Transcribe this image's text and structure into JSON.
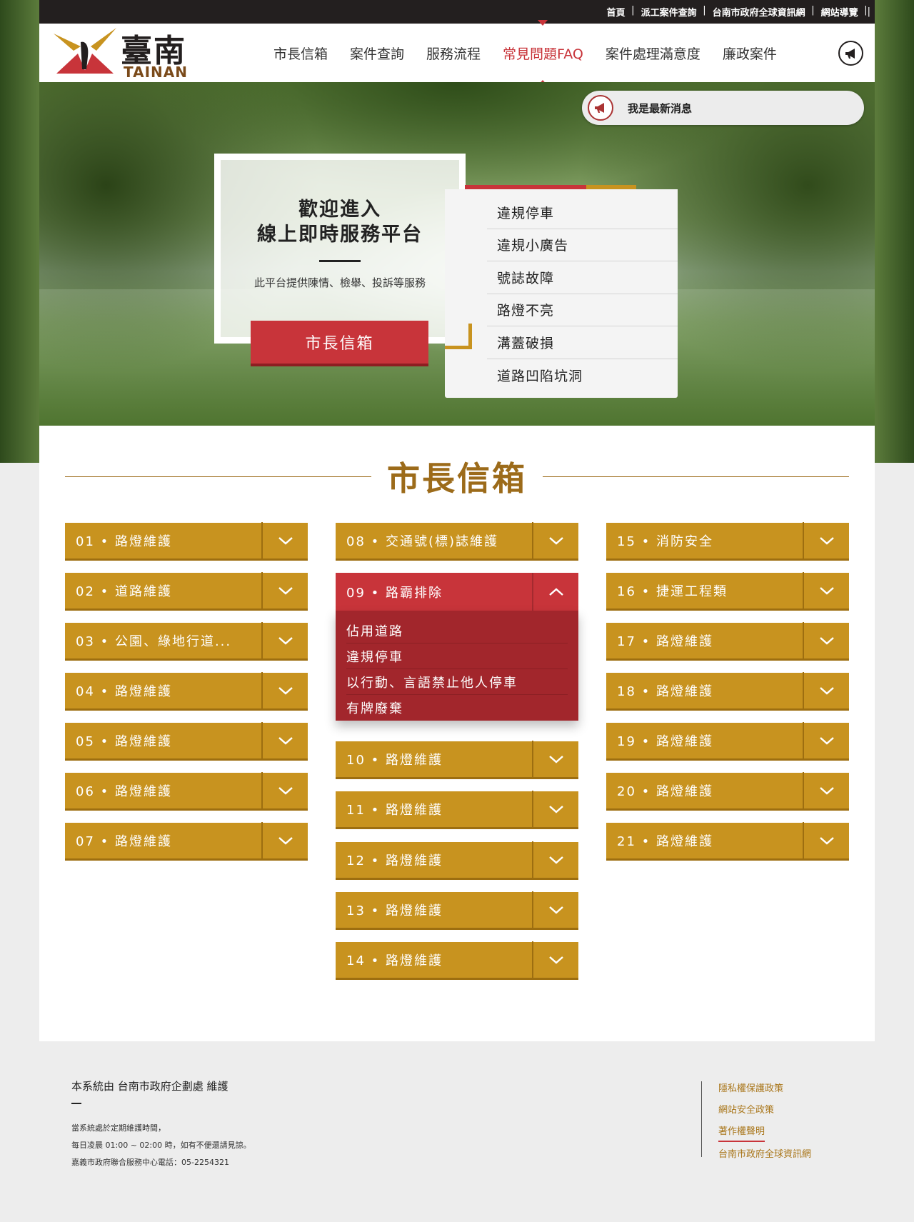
{
  "top_links": [
    "首頁",
    "派工案件查詢",
    "台南市政府全球資訊網",
    "網站導覽"
  ],
  "logo": {
    "chinese": "臺南",
    "english": "TAINAN"
  },
  "nav": [
    "市長信箱",
    "案件查詢",
    "服務流程",
    "常見問題FAQ",
    "案件處理滿意度",
    "廉政案件"
  ],
  "nav_active": "常見問題FAQ",
  "news": "我是最新消息",
  "welcome": {
    "line1": "歡迎進入",
    "line2": "線上即時服務平台",
    "desc": "此平台提供陳情、檢舉、投訴等服務",
    "button": "市長信箱"
  },
  "quick_links": [
    "違規停車",
    "違規小廣告",
    "號誌故障",
    "路燈不亮",
    "溝蓋破損",
    "道路凹陷坑洞"
  ],
  "section_title": "市長信箱",
  "accordion": {
    "col1": [
      "01 • 路燈維護",
      "02 • 道路維護",
      "03 • 公園、綠地行道...",
      "04 • 路燈維護",
      "05 • 路燈維護",
      "06 • 路燈維護",
      "07 • 路燈維護"
    ],
    "col2": [
      "08 • 交通號(標)誌維護",
      "09 • 路霸排除",
      "10 • 路燈維護",
      "11 • 路燈維護",
      "12 • 路燈維護",
      "13 • 路燈維護",
      "14 • 路燈維護"
    ],
    "col3": [
      "15 • 消防安全",
      "16 • 捷運工程類",
      "17 • 路燈維護",
      "18 • 路燈維護",
      "19 • 路燈維護",
      "20 • 路燈維護",
      "21 • 路燈維護"
    ],
    "open_item": "09 • 路霸排除",
    "open_items": [
      "佔用道路",
      "違規停車",
      "以行動、言語禁止他人停車",
      "有牌廢棄"
    ]
  },
  "footer": {
    "maintainer": "本系統由 台南市政府企劃處 維護",
    "notes": [
      "當系統處於定期維護時間，",
      "每日凌晨 01:00 ~ 02:00 時，如有不便還請見諒。",
      "嘉義市政府聯合服務中心電話：05-2254321"
    ],
    "links": [
      "隱私權保護政策",
      "網站安全政策",
      "著作權聲明",
      "台南市政府全球資訊網"
    ],
    "active_link": "著作權聲明"
  },
  "colors": {
    "gold": "#c8931f",
    "red": "#c8343a",
    "dark": "#231f1f"
  }
}
